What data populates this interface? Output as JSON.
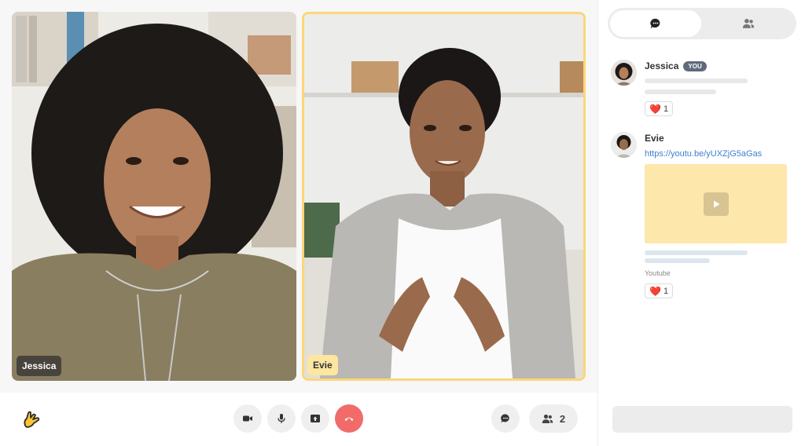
{
  "participants": [
    {
      "name": "Jessica"
    },
    {
      "name": "Evie"
    }
  ],
  "toolbar": {
    "people_count": "2",
    "icons": [
      "camera-icon",
      "mic-icon",
      "share-screen-icon",
      "hang-up-icon",
      "chat-icon",
      "people-icon"
    ]
  },
  "sidebar": {
    "tabs": [
      {
        "icon": "chat-icon",
        "active": true
      },
      {
        "icon": "people-icon",
        "active": false
      }
    ],
    "messages": [
      {
        "author": "Jessica",
        "badge": "YOU",
        "reaction": {
          "emoji": "❤️",
          "count": "1"
        }
      },
      {
        "author": "Evie",
        "link": "https://youtu.be/yUXZjG5aGas",
        "source": "Youtube",
        "reaction": {
          "emoji": "❤️",
          "count": "1"
        }
      }
    ],
    "input_placeholder": ""
  },
  "colors": {
    "active_speaker_border": "#fcd679",
    "hangup": "#f26b6b",
    "link": "#3d7fd0",
    "video_card": "#fde7aa",
    "you_badge": "#5f6b7a"
  }
}
